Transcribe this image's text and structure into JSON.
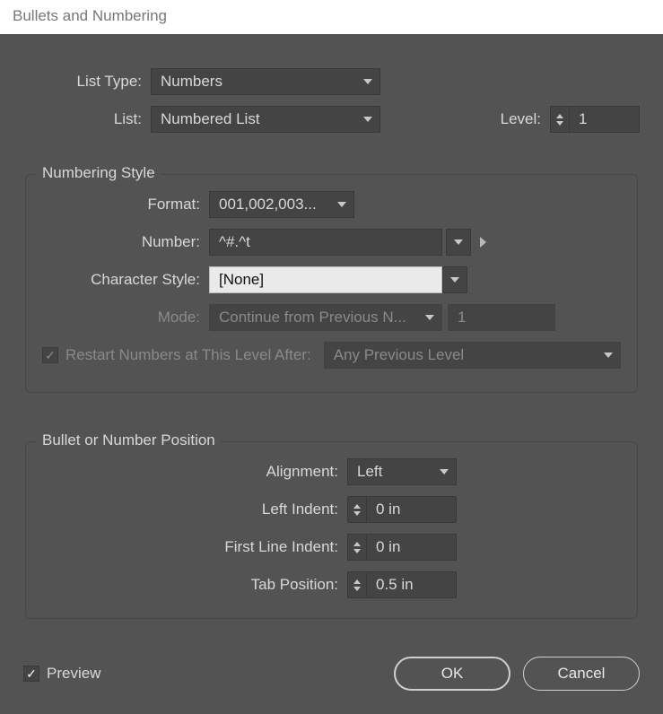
{
  "title": "Bullets and Numbering",
  "top": {
    "listTypeLabel": "List Type:",
    "listTypeValue": "Numbers",
    "listLabel": "List:",
    "listValue": "Numbered List",
    "levelLabel": "Level:",
    "levelValue": "1"
  },
  "numberingStyle": {
    "legend": "Numbering Style",
    "formatLabel": "Format:",
    "formatValue": "001,002,003...",
    "numberLabel": "Number:",
    "numberValue": "^#.^t",
    "charStyleLabel": "Character Style:",
    "charStyleValue": "[None]",
    "modeLabel": "Mode:",
    "modeValue": "Continue from Previous N...",
    "modeStart": "1",
    "restartLabel": "Restart Numbers at This Level After:",
    "restartValue": "Any Previous Level"
  },
  "position": {
    "legend": "Bullet or Number Position",
    "alignmentLabel": "Alignment:",
    "alignmentValue": "Left",
    "leftIndentLabel": "Left Indent:",
    "leftIndentValue": "0 in",
    "firstLineLabel": "First Line Indent:",
    "firstLineValue": "0 in",
    "tabPosLabel": "Tab Position:",
    "tabPosValue": "0.5 in"
  },
  "footer": {
    "previewLabel": "Preview",
    "ok": "OK",
    "cancel": "Cancel"
  }
}
